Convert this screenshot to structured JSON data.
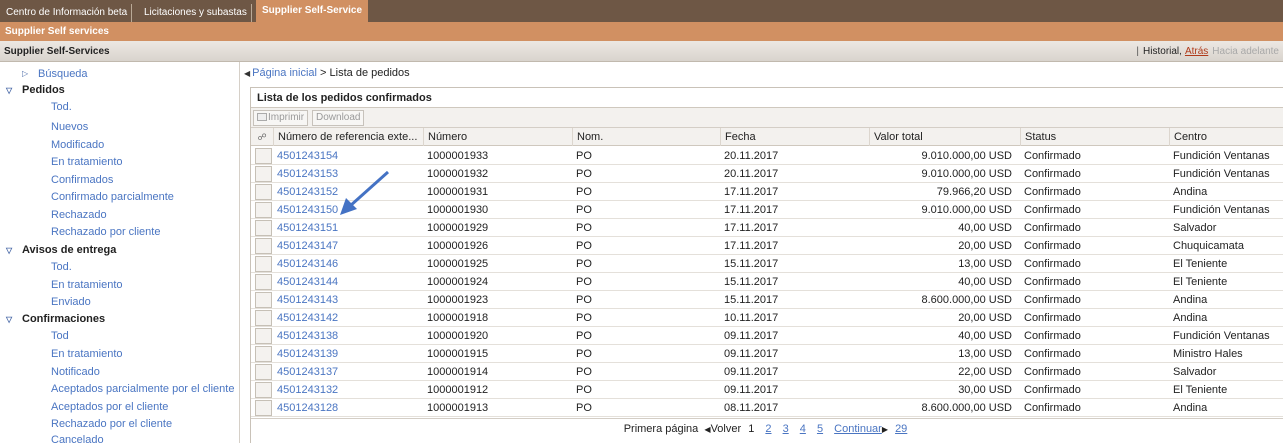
{
  "top_tabs": [
    "Centro de Información beta",
    "Licitaciones y subastas",
    "Supplier Self-Service"
  ],
  "subheader": "Supplier Self services",
  "header": {
    "title": "Supplier Self-Services",
    "historial": "Historial",
    "atras": "Atrás",
    "adelante": "Hacia adelante"
  },
  "sidebar": {
    "busqueda": "Búsqueda",
    "pedidos": {
      "label": "Pedidos",
      "items": [
        "Tod.",
        "Nuevos",
        "Modificado",
        "En tratamiento",
        "Confirmados",
        "Confirmado parcialmente",
        "Rechazado",
        "Rechazado por cliente"
      ]
    },
    "avisos": {
      "label": "Avisos de entrega",
      "items": [
        "Tod.",
        "En tratamiento",
        "Enviado"
      ]
    },
    "confirmaciones": {
      "label": "Confirmaciones",
      "items": [
        "Tod",
        "En tratamiento",
        "Notificado",
        "Aceptados parcialmente por el cliente",
        "Aceptados por el cliente",
        "Rechazado por el cliente",
        "Cancelado"
      ]
    }
  },
  "breadcrumb": {
    "home": "Página inicial",
    "separator": ">",
    "current": "Lista de pedidos"
  },
  "panel": {
    "title": "Lista de los pedidos confirmados",
    "print_label": "Imprimir",
    "download_label": "Download"
  },
  "table": {
    "headers": [
      "Número de referencia exte...",
      "Número",
      "Nom.",
      "Fecha",
      "Valor total",
      "Status",
      "Centro"
    ],
    "rows": [
      [
        "4501243154",
        "1000001933",
        "PO",
        "20.11.2017",
        "9.010.000,00 USD",
        "Confirmado",
        "Fundición Ventanas"
      ],
      [
        "4501243153",
        "1000001932",
        "PO",
        "20.11.2017",
        "9.010.000,00 USD",
        "Confirmado",
        "Fundición Ventanas"
      ],
      [
        "4501243152",
        "1000001931",
        "PO",
        "17.11.2017",
        "79.966,20 USD",
        "Confirmado",
        "Andina"
      ],
      [
        "4501243150",
        "1000001930",
        "PO",
        "17.11.2017",
        "9.010.000,00 USD",
        "Confirmado",
        "Fundición Ventanas"
      ],
      [
        "4501243151",
        "1000001929",
        "PO",
        "17.11.2017",
        "40,00 USD",
        "Confirmado",
        "Salvador"
      ],
      [
        "4501243147",
        "1000001926",
        "PO",
        "17.11.2017",
        "20,00 USD",
        "Confirmado",
        "Chuquicamata"
      ],
      [
        "4501243146",
        "1000001925",
        "PO",
        "15.11.2017",
        "13,00 USD",
        "Confirmado",
        "El Teniente"
      ],
      [
        "4501243144",
        "1000001924",
        "PO",
        "15.11.2017",
        "40,00 USD",
        "Confirmado",
        "El Teniente"
      ],
      [
        "4501243143",
        "1000001923",
        "PO",
        "15.11.2017",
        "8.600.000,00 USD",
        "Confirmado",
        "Andina"
      ],
      [
        "4501243142",
        "1000001918",
        "PO",
        "10.11.2017",
        "20,00 USD",
        "Confirmado",
        "Andina"
      ],
      [
        "4501243138",
        "1000001920",
        "PO",
        "09.11.2017",
        "40,00 USD",
        "Confirmado",
        "Fundición Ventanas"
      ],
      [
        "4501243139",
        "1000001915",
        "PO",
        "09.11.2017",
        "13,00 USD",
        "Confirmado",
        "Ministro Hales"
      ],
      [
        "4501243137",
        "1000001914",
        "PO",
        "09.11.2017",
        "22,00 USD",
        "Confirmado",
        "Salvador"
      ],
      [
        "4501243132",
        "1000001912",
        "PO",
        "09.11.2017",
        "30,00 USD",
        "Confirmado",
        "El Teniente"
      ],
      [
        "4501243128",
        "1000001913",
        "PO",
        "08.11.2017",
        "8.600.000,00 USD",
        "Confirmado",
        "Andina"
      ]
    ]
  },
  "pager": {
    "first": "Primera página",
    "back": "Volver",
    "current": "1",
    "pages": [
      "2",
      "3",
      "4",
      "5"
    ],
    "next": "Continuar",
    "last": "29"
  },
  "annotation": {
    "color": "#4472c4",
    "icon": "arrow-icon"
  }
}
